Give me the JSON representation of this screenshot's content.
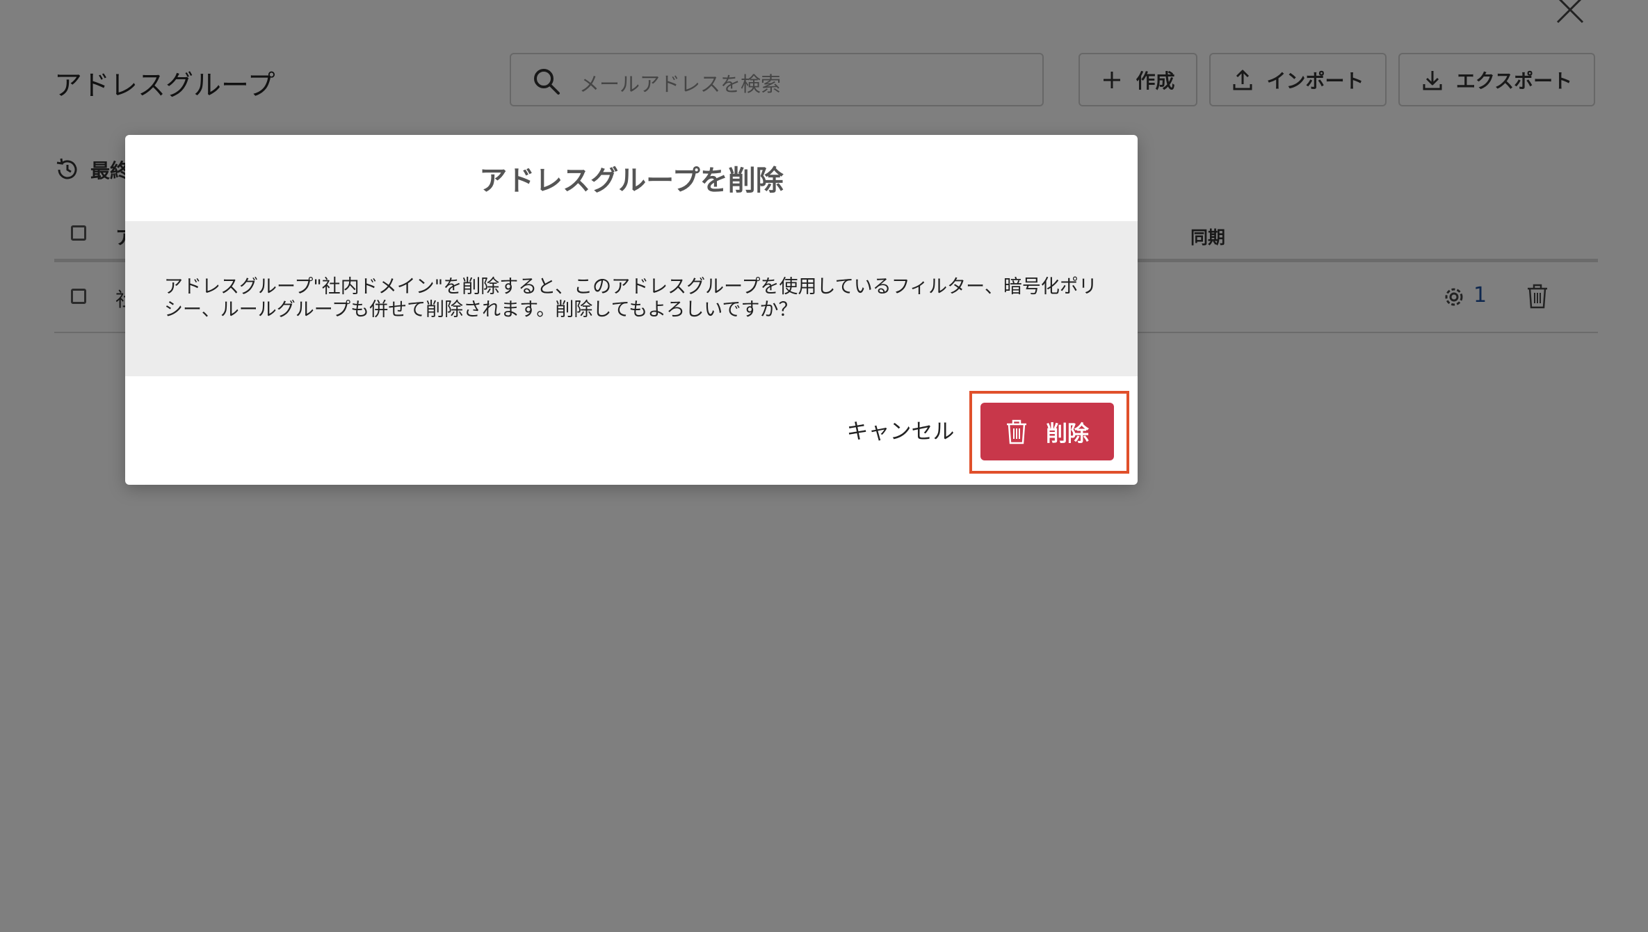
{
  "page": {
    "title": "アドレスグループ",
    "search": {
      "placeholder": "メールアドレスを検索",
      "icon": "search-icon"
    },
    "toolbar": {
      "create_label": "作成",
      "import_label": "インポート",
      "export_label": "エクスポート"
    },
    "last_updated_label": "最終",
    "table": {
      "headers": {
        "name": "ア",
        "sync": "同期"
      },
      "rows": [
        {
          "name": "社",
          "rule_count": "1"
        }
      ]
    }
  },
  "dialog": {
    "title": "アドレスグループを削除",
    "message": "アドレスグループ\"社内ドメイン\"を削除すると、このアドレスグループを使用しているフィルター、暗号化ポリシー、ルールグループも併せて削除されます。削除してもよろしいですか？",
    "cancel_label": "キャンセル",
    "delete_label": "削除"
  },
  "colors": {
    "overlay": "rgba(0,0,0,0.5)",
    "delete_button": "#c8374a",
    "highlight_frame": "#e0502b",
    "dialog_body_bg": "#ececec",
    "count_link": "#1d4f9c"
  }
}
